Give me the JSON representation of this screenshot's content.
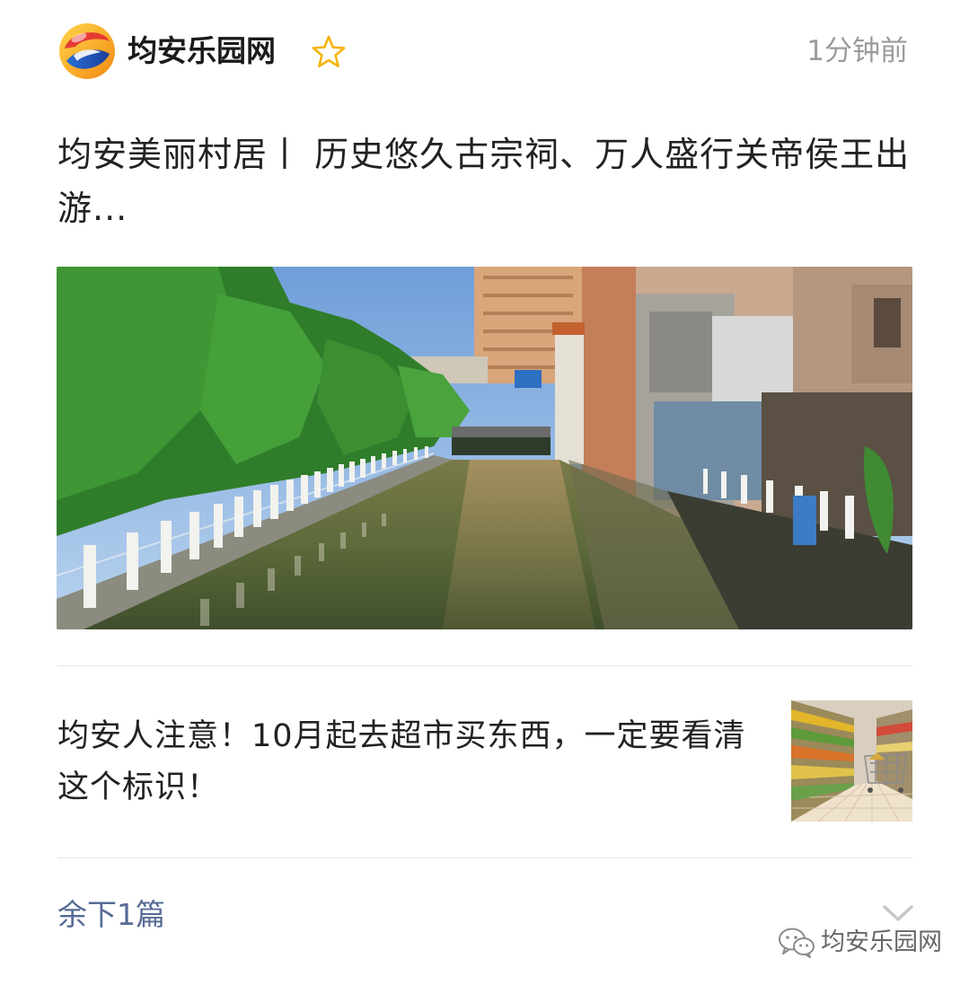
{
  "header": {
    "account_name": "均安乐园网",
    "time": "1分钟前",
    "logo_icon": "account-logo-icon",
    "star_icon": "star-outline-icon",
    "star_color": "#f5b40a"
  },
  "lead_article": {
    "title": "均安美丽村居丨 历史悠久古宗祠、万人盛行关帝侯王出游...",
    "image": "canal-photo"
  },
  "articles": [
    {
      "title": "均安人注意！10月起去超市买东西，一定要看清这个标识！",
      "thumbnail": "supermarket-thumbnail"
    }
  ],
  "footer": {
    "more_label": "余下1篇",
    "more_color": "#576b95",
    "chevron_icon": "chevron-down-icon",
    "watermark_icon": "wechat-icon",
    "watermark_text": "均安乐园网"
  }
}
